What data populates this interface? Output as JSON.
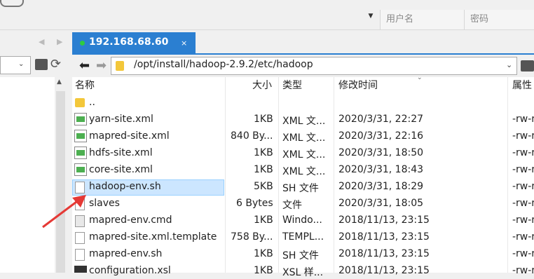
{
  "top": {
    "username_placeholder": "用户名",
    "password_placeholder": "密码"
  },
  "tab": {
    "host": "192.168.68.60",
    "close": "×"
  },
  "path": {
    "value": "/opt/install/hadoop-2.9.2/etc/hadoop"
  },
  "columns": {
    "name": "名称",
    "size": "大小",
    "type": "类型",
    "modified": "修改时间",
    "attrs": "属性"
  },
  "rows": [
    {
      "name": "..",
      "size": "",
      "type": "",
      "modified": "",
      "attrs": "",
      "icon": "folder-icon"
    },
    {
      "name": "yarn-site.xml",
      "size": "1KB",
      "type": "XML 文...",
      "modified": "2020/3/31, 22:27",
      "attrs": "-rw-r",
      "icon": "xml-file-icon"
    },
    {
      "name": "mapred-site.xml",
      "size": "840 By...",
      "type": "XML 文...",
      "modified": "2020/3/31, 22:16",
      "attrs": "-rw-r",
      "icon": "xml-file-icon"
    },
    {
      "name": "hdfs-site.xml",
      "size": "1KB",
      "type": "XML 文...",
      "modified": "2020/3/31, 18:50",
      "attrs": "-rw-r",
      "icon": "xml-file-icon"
    },
    {
      "name": "core-site.xml",
      "size": "1KB",
      "type": "XML 文...",
      "modified": "2020/3/31, 18:43",
      "attrs": "-rw-r",
      "icon": "xml-file-icon"
    },
    {
      "name": "hadoop-env.sh",
      "size": "5KB",
      "type": "SH 文件",
      "modified": "2020/3/31, 18:29",
      "attrs": "-rw-r",
      "icon": "file-icon"
    },
    {
      "name": "slaves",
      "size": "6 Bytes",
      "type": "文件",
      "modified": "2020/3/31, 18:05",
      "attrs": "-rw-r",
      "icon": "file-icon"
    },
    {
      "name": "mapred-env.cmd",
      "size": "1KB",
      "type": "Windo...",
      "modified": "2018/11/13, 23:15",
      "attrs": "-rw-r",
      "icon": "cmd-file-icon"
    },
    {
      "name": "mapred-site.xml.template",
      "size": "758 By...",
      "type": "TEMPL...",
      "modified": "2018/11/13, 23:15",
      "attrs": "-rw-r",
      "icon": "file-icon"
    },
    {
      "name": "mapred-env.sh",
      "size": "1KB",
      "type": "SH 文件",
      "modified": "2018/11/13, 23:15",
      "attrs": "-rw-r",
      "icon": "file-icon"
    },
    {
      "name": "configuration.xsl",
      "size": "1KB",
      "type": "XSL 样...",
      "modified": "2018/11/13, 23:15",
      "attrs": "-rw-r",
      "icon": "xsl-file-icon"
    }
  ],
  "selected_row": "hadoop-env.sh",
  "colors": {
    "accent": "#2b7fd1",
    "selection": "#cce6ff",
    "annotation_arrow": "#e53935"
  }
}
